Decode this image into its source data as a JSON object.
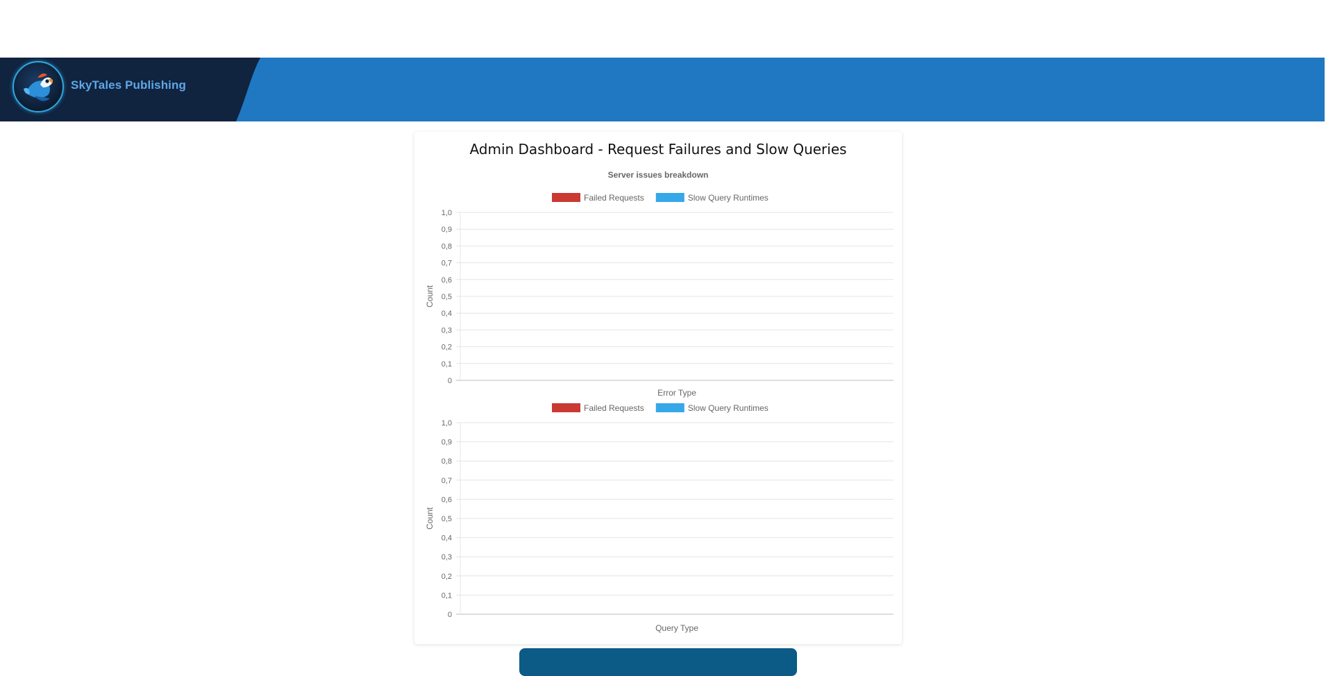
{
  "header": {
    "brand_name": "SkyTales Publishing",
    "logo_icon": "parrot-logo-icon",
    "bar_color": "#1f78c1",
    "brand_panel_color": "#10233f"
  },
  "main": {
    "title": "Admin Dashboard - Request Failures and Slow Queries"
  },
  "chart_data": [
    {
      "type": "bar",
      "title": "Server issues breakdown",
      "xlabel": "Error Type",
      "ylabel": "Count",
      "ylim": [
        0,
        1
      ],
      "yticks": [
        "0",
        "0,1",
        "0,2",
        "0,3",
        "0,4",
        "0,5",
        "0,6",
        "0,7",
        "0,8",
        "0,9",
        "1,0"
      ],
      "categories": [],
      "legend_position": "top",
      "grid": true,
      "series": [
        {
          "name": "Failed Requests",
          "color": "#c93a32",
          "values": []
        },
        {
          "name": "Slow Query Runtimes",
          "color": "#36a7e9",
          "values": []
        }
      ]
    },
    {
      "type": "bar",
      "title": "",
      "xlabel": "Query Type",
      "ylabel": "Count",
      "ylim": [
        0,
        1
      ],
      "yticks": [
        "0",
        "0,1",
        "0,2",
        "0,3",
        "0,4",
        "0,5",
        "0,6",
        "0,7",
        "0,8",
        "0,9",
        "1,0"
      ],
      "categories": [],
      "legend_position": "top",
      "grid": true,
      "series": [
        {
          "name": "Failed Requests",
          "color": "#c93a32",
          "values": []
        },
        {
          "name": "Slow Query Runtimes",
          "color": "#36a7e9",
          "values": []
        }
      ]
    }
  ]
}
